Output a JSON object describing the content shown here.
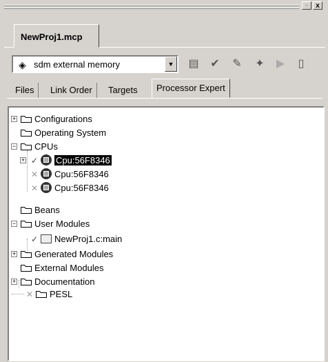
{
  "window": {
    "max_glyph": "▫",
    "close_glyph": "x"
  },
  "doc_tab": {
    "label": "NewProj1.mcp"
  },
  "toolbar": {
    "target_select": {
      "value": "sdm external memory",
      "icon": "target-icon"
    },
    "buttons": [
      {
        "name": "settings-icon",
        "glyph": "▤"
      },
      {
        "name": "checkmark-icon",
        "glyph": "✔"
      },
      {
        "name": "make-icon",
        "glyph": "✎"
      },
      {
        "name": "debug-icon",
        "glyph": "✦"
      },
      {
        "name": "run-icon",
        "glyph": "▶"
      },
      {
        "name": "project-inspector-icon",
        "glyph": "▯"
      }
    ]
  },
  "tabs": [
    "Files",
    "Link Order",
    "Targets",
    "Processor Expert"
  ],
  "active_tab": "Processor Expert",
  "tree": {
    "configurations": "Configurations",
    "operating_system": "Operating System",
    "cpus": "CPUs",
    "cpu_items": [
      "Cpu:56F8346",
      "Cpu:56F8346",
      "Cpu:56F8346"
    ],
    "beans": "Beans",
    "user_modules": "User Modules",
    "user_module_item": "NewProj1.c:main",
    "generated_modules": "Generated Modules",
    "external_modules": "External Modules",
    "documentation": "Documentation",
    "pesl": "PESL"
  }
}
